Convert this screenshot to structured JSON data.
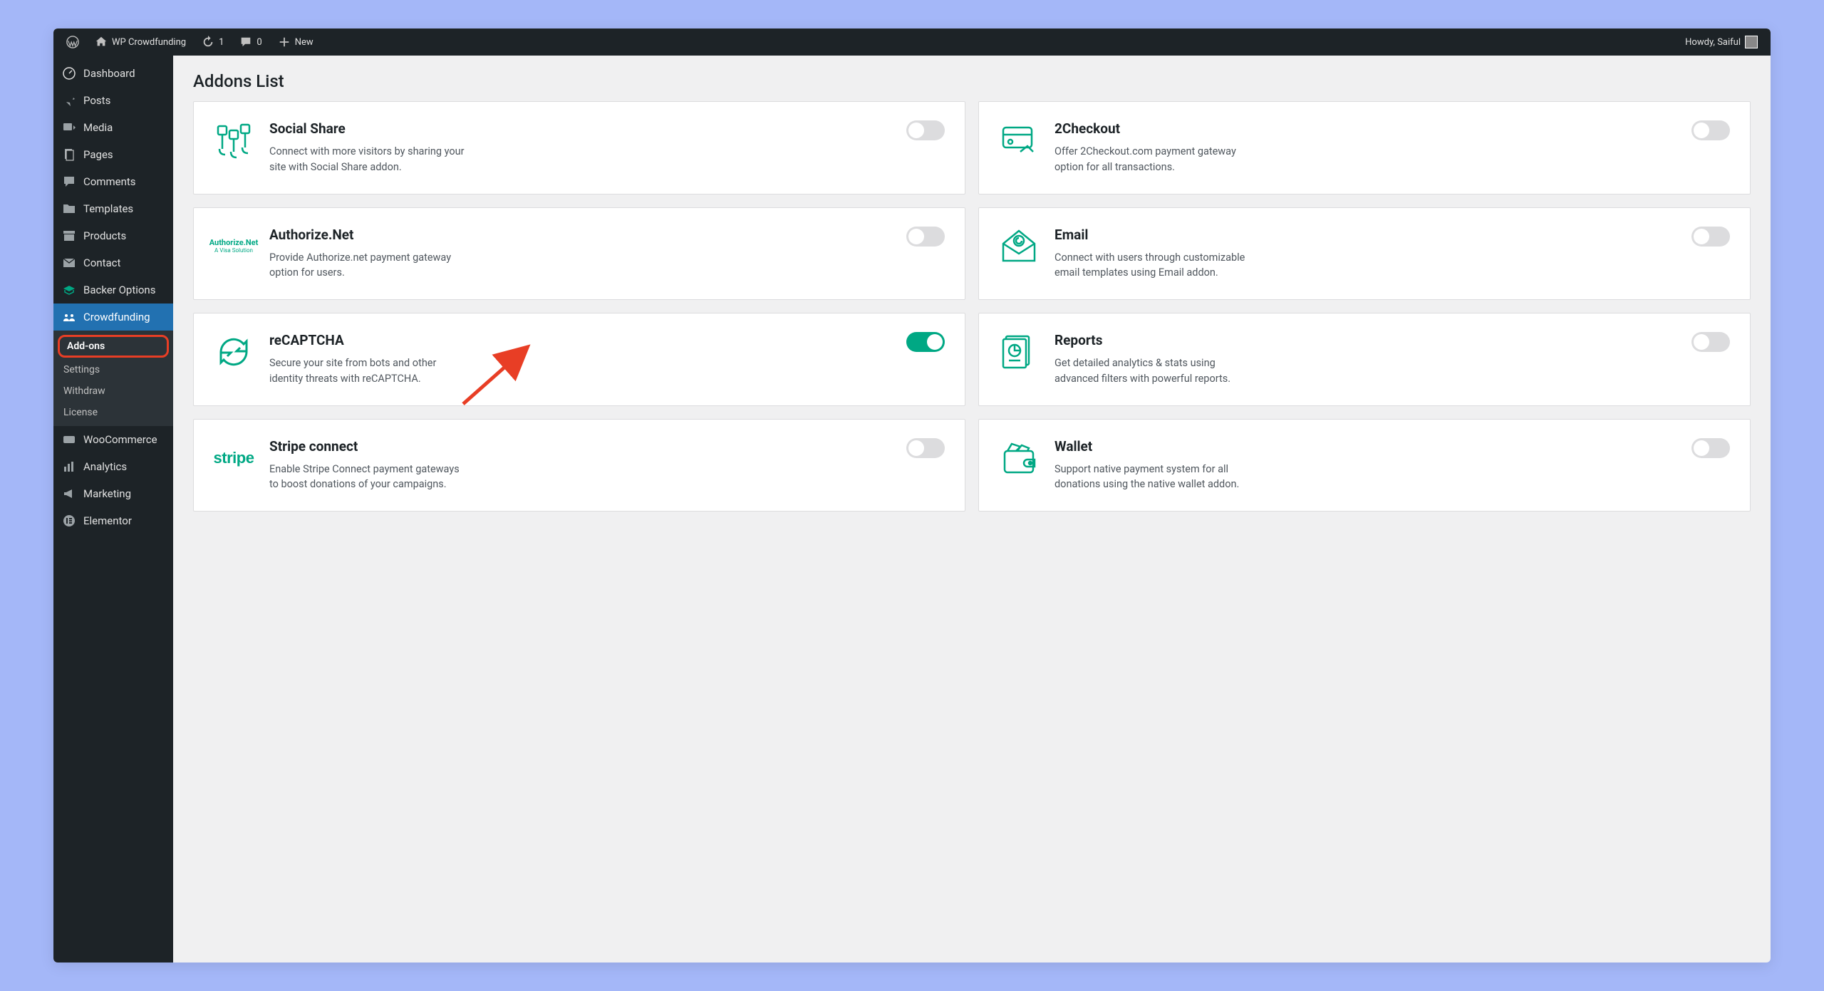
{
  "adminbar": {
    "site_name": "WP Crowdfunding",
    "updates": "1",
    "comments": "0",
    "new_label": "New",
    "greeting": "Howdy, Saiful"
  },
  "sidebar": {
    "items": [
      {
        "id": "dashboard",
        "label": "Dashboard"
      },
      {
        "id": "posts",
        "label": "Posts"
      },
      {
        "id": "media",
        "label": "Media"
      },
      {
        "id": "pages",
        "label": "Pages"
      },
      {
        "id": "comments",
        "label": "Comments"
      },
      {
        "id": "templates",
        "label": "Templates"
      },
      {
        "id": "products",
        "label": "Products"
      },
      {
        "id": "contact",
        "label": "Contact"
      },
      {
        "id": "backer",
        "label": "Backer Options"
      },
      {
        "id": "crowdfunding",
        "label": "Crowdfunding"
      }
    ],
    "submenu": [
      {
        "id": "addons",
        "label": "Add-ons",
        "highlighted": true
      },
      {
        "id": "settings",
        "label": "Settings"
      },
      {
        "id": "withdraw",
        "label": "Withdraw"
      },
      {
        "id": "license",
        "label": "License"
      }
    ],
    "items2": [
      {
        "id": "woocommerce",
        "label": "WooCommerce"
      },
      {
        "id": "analytics",
        "label": "Analytics"
      },
      {
        "id": "marketing",
        "label": "Marketing"
      },
      {
        "id": "elementor",
        "label": "Elementor"
      }
    ]
  },
  "page_title": "Addons List",
  "addons": [
    {
      "id": "social-share",
      "title": "Social Share",
      "desc": "Connect with more visitors by sharing your site with Social Share addon.",
      "enabled": false
    },
    {
      "id": "2checkout",
      "title": "2Checkout",
      "desc": "Offer 2Checkout.com payment gateway option for all transactions.",
      "enabled": false
    },
    {
      "id": "authorize",
      "title": "Authorize.Net",
      "desc": "Provide Authorize.net payment gateway option for users.",
      "enabled": false
    },
    {
      "id": "email",
      "title": "Email",
      "desc": "Connect with users through customizable email templates using Email addon.",
      "enabled": false
    },
    {
      "id": "recaptcha",
      "title": "reCAPTCHA",
      "desc": "Secure your site from bots and other identity threats with reCAPTCHA.",
      "enabled": true
    },
    {
      "id": "reports",
      "title": "Reports",
      "desc": "Get detailed analytics & stats using advanced filters with powerful reports.",
      "enabled": false
    },
    {
      "id": "stripe",
      "title": "Stripe connect",
      "desc": "Enable Stripe Connect payment gateways to boost donations of your campaigns.",
      "enabled": false
    },
    {
      "id": "wallet",
      "title": "Wallet",
      "desc": "Support native payment system for all donations using the native wallet addon.",
      "enabled": false
    }
  ],
  "authorize_icon_text": {
    "main": "Authorize.Net",
    "sub": "A Visa Solution"
  },
  "stripe_icon_text": "stripe",
  "accent": "#00a884",
  "annotation_color": "#e83e25"
}
